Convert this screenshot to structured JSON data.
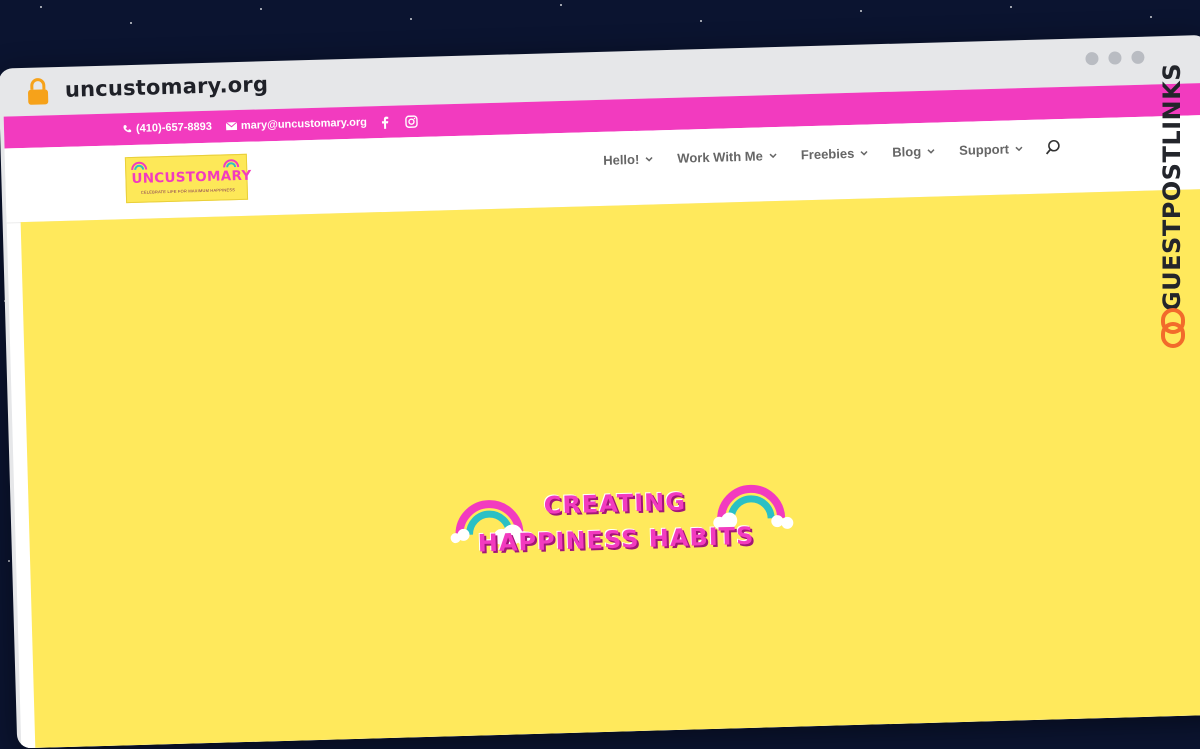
{
  "browser": {
    "url": "uncustomary.org",
    "lock_icon": "lock-icon",
    "window_dots": 3
  },
  "topbar": {
    "phone": "(410)-657-8893",
    "email": "mary@uncustomary.org",
    "social": [
      "facebook-icon",
      "instagram-icon"
    ],
    "bg_color": "#f23bbf"
  },
  "logo": {
    "text": "UNCUSTOMARY",
    "tagline": "CELEBRATE LIFE FOR MAXIMUM HAPPINESS"
  },
  "nav": {
    "items": [
      {
        "label": "Hello!"
      },
      {
        "label": "Work With Me"
      },
      {
        "label": "Freebies"
      },
      {
        "label": "Blog"
      },
      {
        "label": "Support"
      }
    ],
    "search_icon": "search-icon"
  },
  "hero": {
    "line1": "CREATING",
    "line2": "HAPPINESS HABITS",
    "bg_color": "#ffe95c"
  },
  "watermark": {
    "text": "GUESTPOSTLINKS",
    "icon": "link-icon"
  }
}
